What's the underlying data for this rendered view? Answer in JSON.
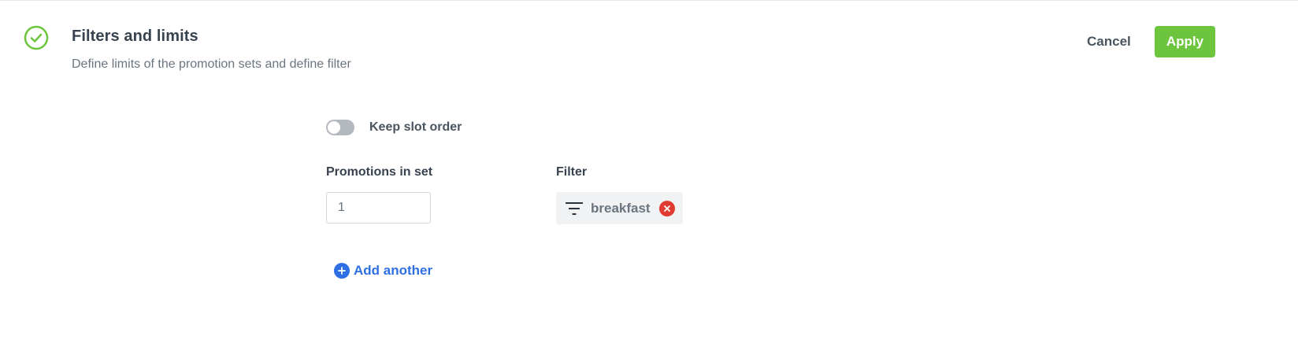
{
  "header": {
    "title": "Filters and limits",
    "subtitle": "Define limits of the promotion sets and define filter",
    "status_icon": "check-circle-icon",
    "status_color": "#6cc53c"
  },
  "actions": {
    "cancel_label": "Cancel",
    "apply_label": "Apply",
    "apply_color": "#6cc53c"
  },
  "slot_order": {
    "label": "Keep slot order",
    "enabled": false
  },
  "promotions": {
    "label": "Promotions in set",
    "value": "1"
  },
  "filter": {
    "label": "Filter",
    "icon": "filter-icon",
    "chips": [
      {
        "text": "breakfast",
        "remove_icon": "close-circle-icon",
        "remove_color": "#e03b30"
      }
    ]
  },
  "add_another": {
    "label": "Add another",
    "icon": "plus-circle-icon",
    "color": "#2f6fe4"
  }
}
